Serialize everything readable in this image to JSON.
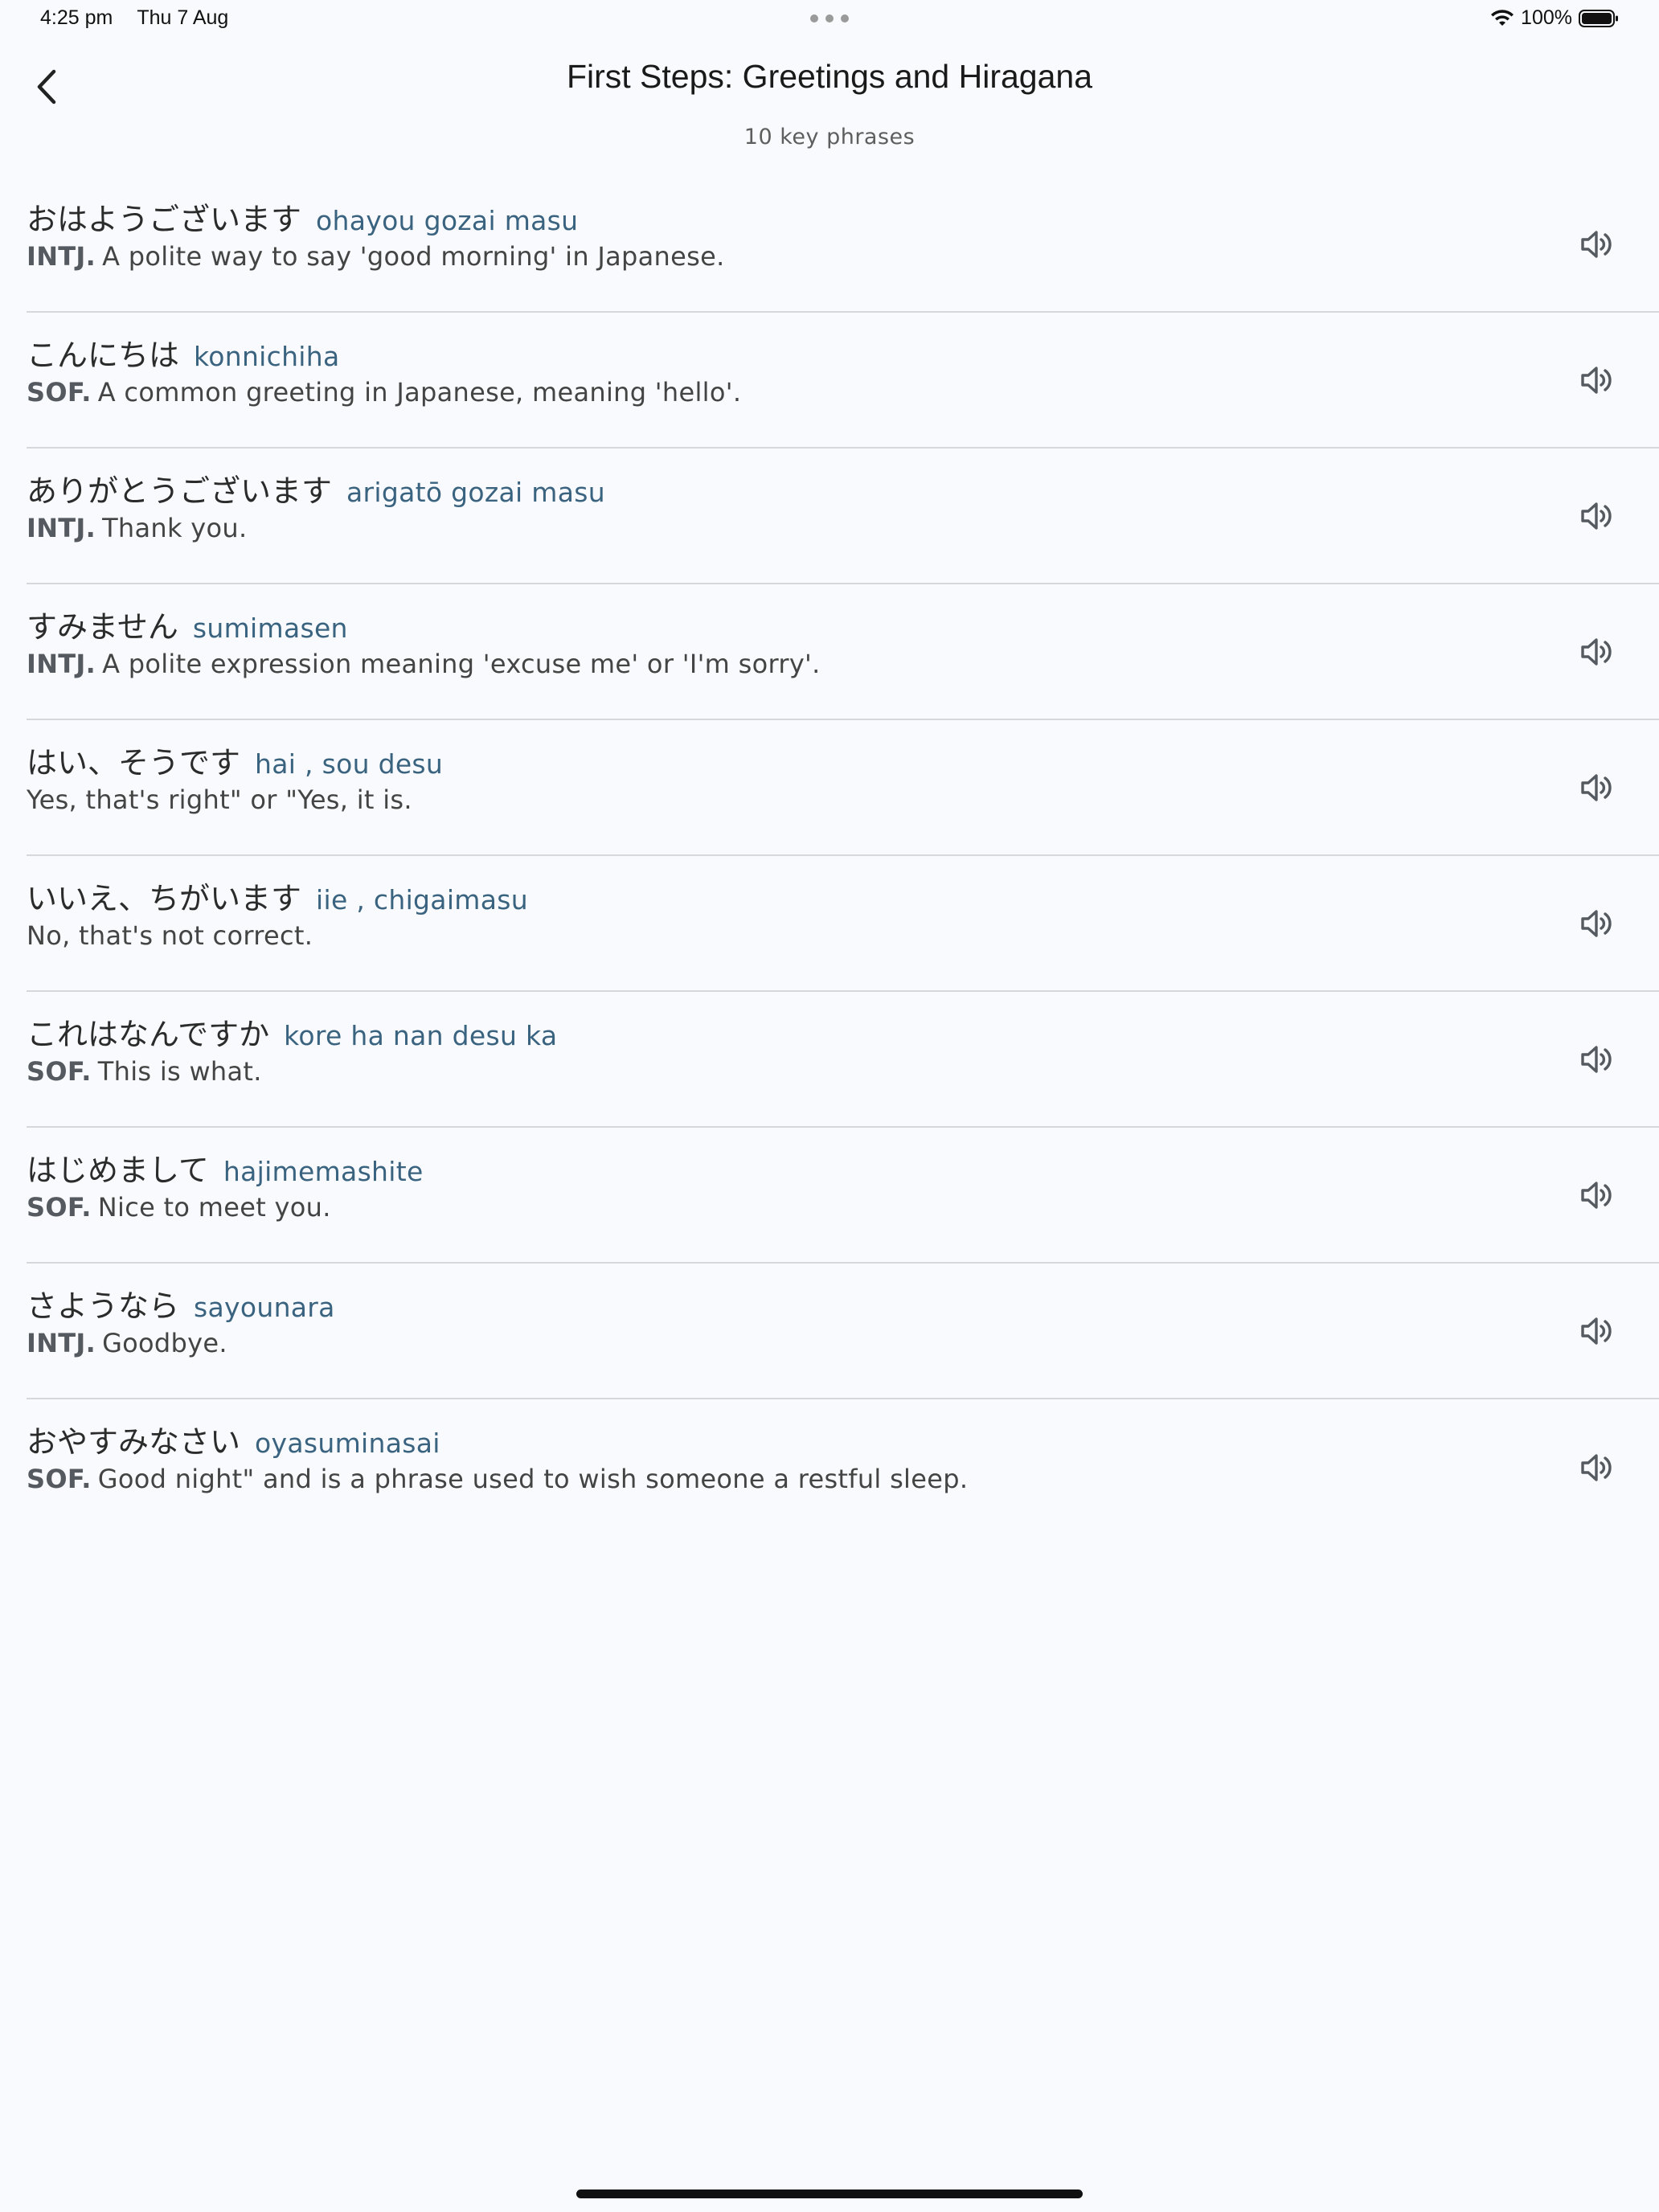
{
  "status_bar": {
    "time": "4:25 pm",
    "date": "Thu 7 Aug",
    "battery_percent": "100%",
    "icons": [
      "wifi-icon",
      "battery-icon"
    ]
  },
  "header": {
    "title": "First Steps: Greetings and Hiragana",
    "subtitle": "10 key phrases",
    "back_icon": "chevron-left-icon"
  },
  "phrases": [
    {
      "japanese": "おはようございます",
      "romaji": "ohayou gozai masu",
      "pos": "INTJ.",
      "meaning": "A polite way to say 'good morning' in Japanese."
    },
    {
      "japanese": "こんにちは",
      "romaji": "konnichiha",
      "pos": "SOF.",
      "meaning": "A common greeting in Japanese, meaning 'hello'."
    },
    {
      "japanese": "ありがとうございます",
      "romaji": "arigatō gozai masu",
      "pos": "INTJ.",
      "meaning": "Thank you."
    },
    {
      "japanese": "すみません",
      "romaji": "sumimasen",
      "pos": "INTJ.",
      "meaning": "A polite expression meaning 'excuse me' or 'I'm sorry'."
    },
    {
      "japanese": "はい、そうです",
      "romaji": "hai , sou desu",
      "pos": "",
      "meaning": "Yes, that's right\" or \"Yes, it is."
    },
    {
      "japanese": "いいえ、ちがいます",
      "romaji": "iie , chigaimasu",
      "pos": "",
      "meaning": "No, that's not correct."
    },
    {
      "japanese": "これはなんですか",
      "romaji": "kore ha nan desu ka",
      "pos": "SOF.",
      "meaning": "This is what."
    },
    {
      "japanese": "はじめまして",
      "romaji": "hajimemashite",
      "pos": "SOF.",
      "meaning": "Nice to meet you."
    },
    {
      "japanese": "さようなら",
      "romaji": "sayounara",
      "pos": "INTJ.",
      "meaning": "Goodbye."
    },
    {
      "japanese": "おやすみなさい",
      "romaji": "oyasuminasai",
      "pos": "SOF.",
      "meaning": "Good night\" and is a phrase used to wish someone a restful sleep."
    }
  ],
  "row_action_icon": "speaker-icon",
  "colors": {
    "background": "#f9fafd",
    "romaji": "#3a6380",
    "divider": "#d6d7da",
    "icon": "#555a60"
  }
}
